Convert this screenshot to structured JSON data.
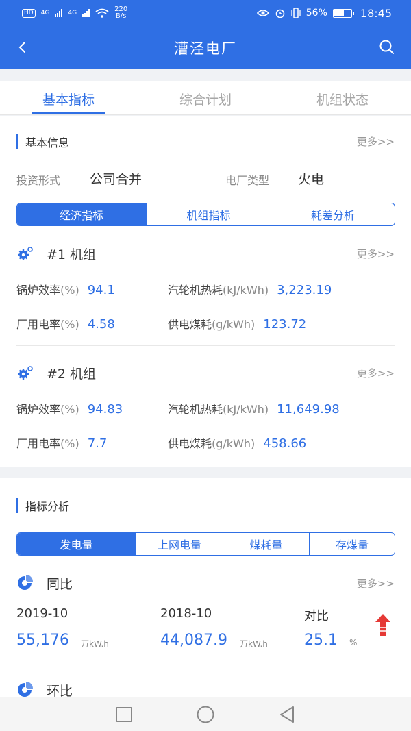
{
  "status_bar": {
    "hd_label": "HD",
    "network_1": "4G",
    "network_2": "4G",
    "speed": "220",
    "speed_unit": "B/s",
    "battery": "56%",
    "time": "18:45"
  },
  "header": {
    "title": "漕泾电厂"
  },
  "tabs": [
    {
      "label": "基本指标",
      "active": true
    },
    {
      "label": "综合计划",
      "active": false
    },
    {
      "label": "机组状态",
      "active": false
    }
  ],
  "basic_info": {
    "title": "基本信息",
    "more": "更多>>",
    "fields": [
      {
        "label": "投资形式",
        "value": "公司合并"
      },
      {
        "label": "电厂类型",
        "value": "火电"
      }
    ]
  },
  "segment1": [
    "经济指标",
    "机组指标",
    "耗差分析"
  ],
  "units": [
    {
      "name": "#1 机组",
      "more": "更多>>",
      "metrics": [
        {
          "label": "锅炉效率",
          "unit": "(%)",
          "value": "94.1"
        },
        {
          "label": "汽轮机热耗",
          "unit": "(kJ/kWh)",
          "value": "3,223.19"
        },
        {
          "label": "厂用电率",
          "unit": "(%)",
          "value": "4.58"
        },
        {
          "label": "供电煤耗",
          "unit": "(g/kWh)",
          "value": "123.72"
        }
      ]
    },
    {
      "name": "#2 机组",
      "more": "更多>>",
      "metrics": [
        {
          "label": "锅炉效率",
          "unit": "(%)",
          "value": "94.83"
        },
        {
          "label": "汽轮机热耗",
          "unit": "(kJ/kWh)",
          "value": "11,649.98"
        },
        {
          "label": "厂用电率",
          "unit": "(%)",
          "value": "7.7"
        },
        {
          "label": "供电煤耗",
          "unit": "(g/kWh)",
          "value": "458.66"
        }
      ]
    }
  ],
  "analysis": {
    "title": "指标分析",
    "segment": [
      "发电量",
      "上网电量",
      "煤耗量",
      "存煤量"
    ],
    "yoy": {
      "title": "同比",
      "more": "更多>>",
      "current_period": "2019-10",
      "current_value": "55,176",
      "current_unit": "万kW.h",
      "previous_period": "2018-10",
      "previous_value": "44,087.9",
      "previous_unit": "万kW.h",
      "compare_label": "对比",
      "compare_value": "25.1",
      "compare_unit": "%"
    },
    "mom": {
      "title": "环比"
    }
  },
  "colors": {
    "primary": "#2f6fe4",
    "up_arrow": "#e53935"
  }
}
